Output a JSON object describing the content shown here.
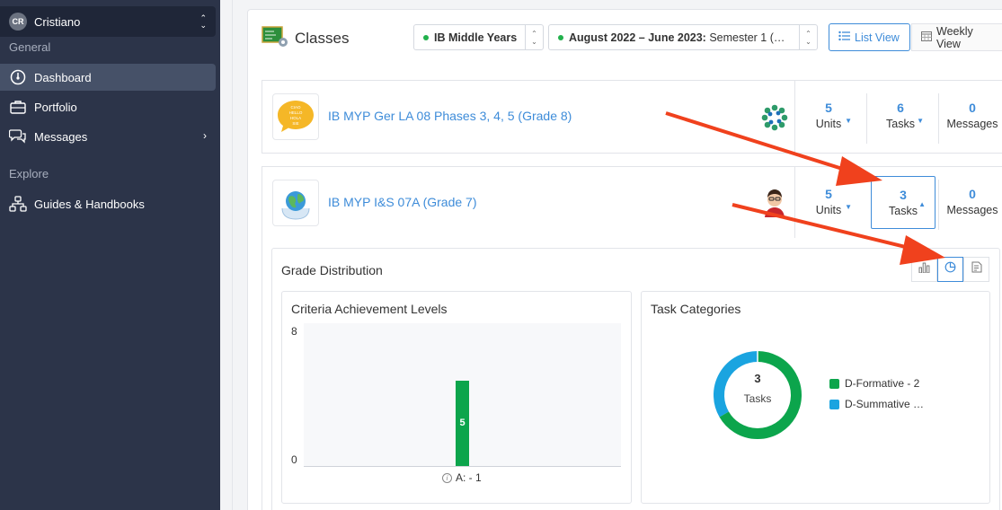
{
  "sidebar": {
    "user": {
      "initials": "CR",
      "name": "Cristiano"
    },
    "sections": {
      "general": "General",
      "explore": "Explore"
    },
    "items": [
      {
        "label": "Dashboard",
        "icon": "dashboard-gauge-icon",
        "active": true
      },
      {
        "label": "Portfolio",
        "icon": "briefcase-icon"
      },
      {
        "label": "Messages",
        "icon": "chat-bubbles-icon"
      },
      {
        "label": "Guides & Handbooks",
        "icon": "sitemap-icon"
      }
    ]
  },
  "header": {
    "title": "Classes",
    "program_select": "IB Middle Years",
    "term_select_bold": "August 2022 – June 2023:",
    "term_select_rest": " Semester 1 (…",
    "list_view": "List View",
    "weekly_view": "Weekly View"
  },
  "classes": [
    {
      "name": "IB MYP Ger LA 08 Phases 3, 4, 5 (Grade 8)",
      "thumb_lines": [
        "CIAO",
        "HELLO",
        "HOLA",
        "SIE"
      ],
      "units": {
        "value": "5",
        "label": "Units"
      },
      "tasks": {
        "value": "6",
        "label": "Tasks"
      },
      "messages": {
        "value": "0",
        "label": "Messages"
      }
    },
    {
      "name": "IB MYP I&S 07A (Grade 7)",
      "units": {
        "value": "5",
        "label": "Units"
      },
      "tasks": {
        "value": "3",
        "label": "Tasks"
      },
      "messages": {
        "value": "0",
        "label": "Messages"
      }
    }
  ],
  "grade_distribution": {
    "title": "Grade Distribution",
    "criteria_title": "Criteria Achievement Levels",
    "categories_title": "Task Categories",
    "donut_total": "3",
    "donut_label": "Tasks"
  },
  "chart_data": [
    {
      "type": "bar",
      "title": "Criteria Achievement Levels",
      "categories": [
        "A: - 1"
      ],
      "values": [
        5
      ],
      "ylim": [
        0,
        8
      ],
      "yticks": [
        "0",
        "8"
      ],
      "bar_color": "#0ca54c"
    },
    {
      "type": "pie",
      "title": "Task Categories",
      "slices": [
        {
          "label": "D-Formative - 2",
          "value": 2,
          "color": "#0ca54c"
        },
        {
          "label": "D-Summative …",
          "value": 1,
          "color": "#1aa4e0"
        }
      ]
    }
  ],
  "colors": {
    "accent": "#3e8cd9",
    "sidebar_bg": "#2c3449",
    "annotation_arrow": "#f0411d"
  }
}
